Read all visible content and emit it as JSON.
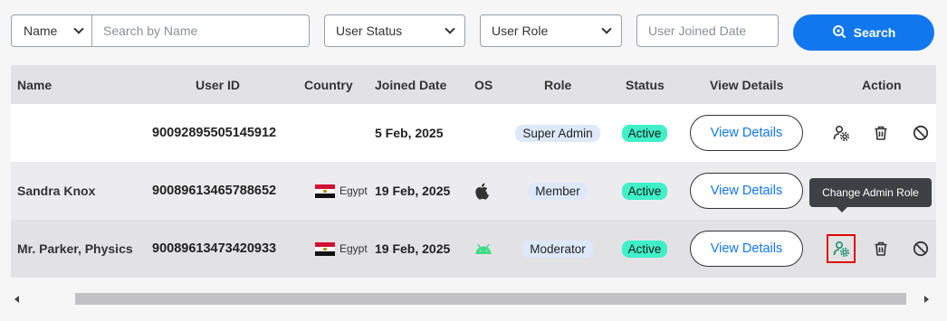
{
  "filters": {
    "name_select": "Name",
    "name_placeholder": "Search by Name",
    "status_select": "User Status",
    "role_select": "User Role",
    "date_placeholder": "User Joined Date",
    "search_label": "Search"
  },
  "columns": {
    "name": "Name",
    "user_id": "User ID",
    "country": "Country",
    "joined": "Joined Date",
    "os": "OS",
    "role": "Role",
    "status": "Status",
    "view": "View Details",
    "action": "Action"
  },
  "rows": [
    {
      "name": "",
      "user_id": "90092895505145912",
      "country": "",
      "joined": "5 Feb, 2025",
      "os": "",
      "role": "Super Admin",
      "status": "Active",
      "view": "View Details"
    },
    {
      "name": "Sandra Knox",
      "user_id": "90089613465788652",
      "country": "Egypt",
      "joined": "19 Feb, 2025",
      "os": "apple-icon",
      "role": "Member",
      "status": "Active",
      "view": "View Details"
    },
    {
      "name": "Mr. Parker, Physics",
      "user_id": "90089613473420933",
      "country": "Egypt",
      "joined": "19 Feb, 2025",
      "os": "android-icon",
      "role": "Moderator",
      "status": "Active",
      "view": "View Details"
    }
  ],
  "tooltip": "Change Admin Role",
  "colors": {
    "primary": "#1177ee",
    "active_badge": "#3ff0c8",
    "role_badge": "#dde9fb",
    "android": "#3ddc84",
    "highlight": "#e00000"
  }
}
